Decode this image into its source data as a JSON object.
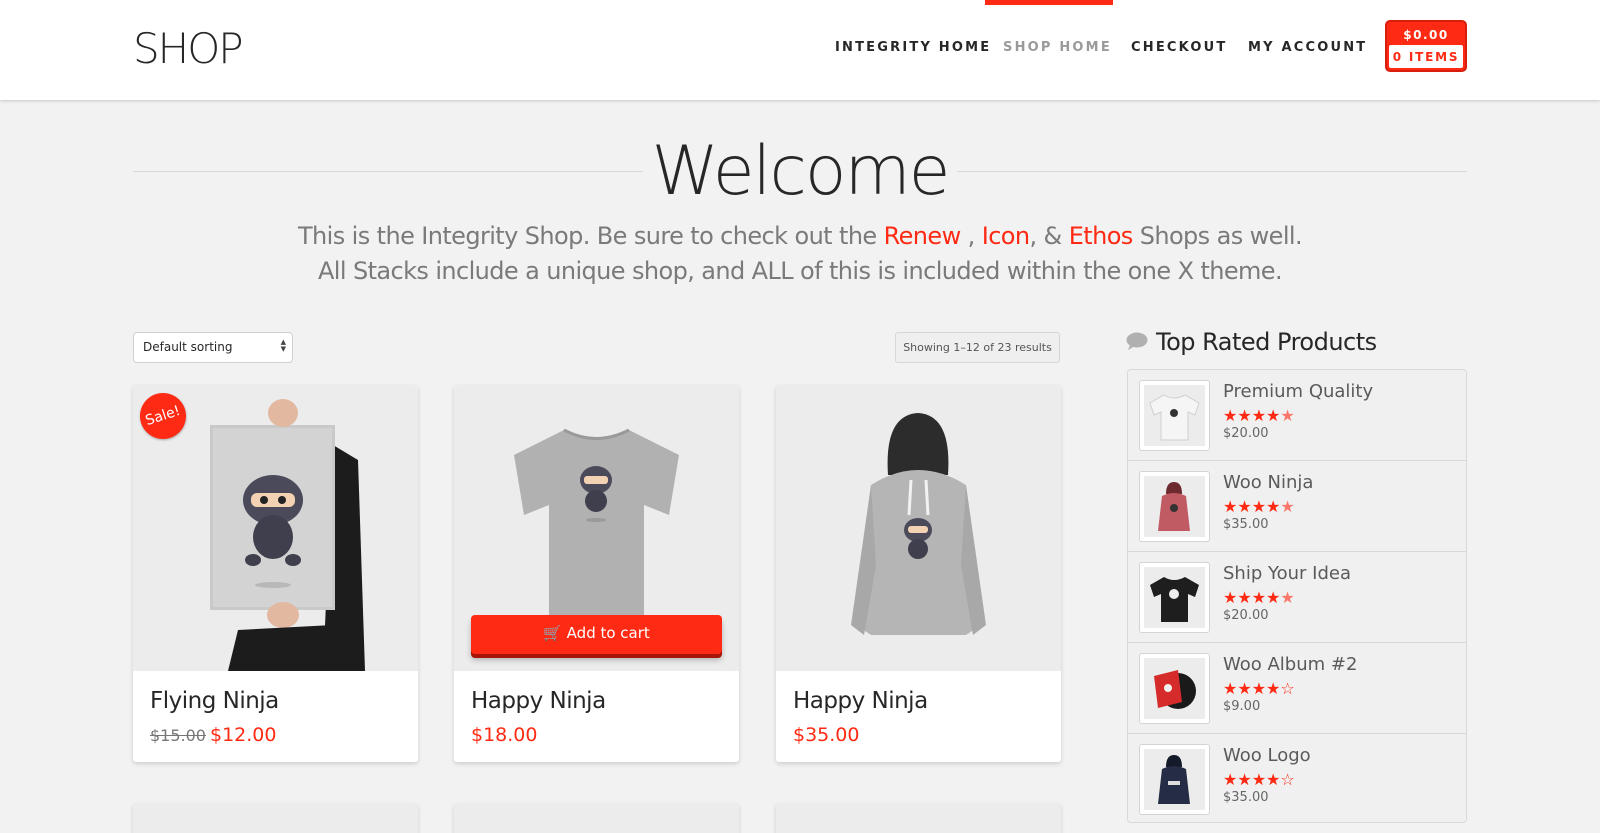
{
  "header": {
    "logo": "SHOP",
    "nav": [
      {
        "label": "INTEGRITY HOME",
        "active": false
      },
      {
        "label": "SHOP HOME",
        "active": true
      },
      {
        "label": "CHECKOUT",
        "active": false
      },
      {
        "label": "MY ACCOUNT",
        "active": false
      }
    ],
    "cart": {
      "total": "$0.00",
      "items": "0 ITEMS"
    }
  },
  "welcome": {
    "title": "Welcome",
    "line1_a": "This is the Integrity Shop. Be sure to check out the ",
    "link_renew": "Renew",
    "sep1": " , ",
    "link_icon": "Icon",
    "sep2": ", & ",
    "link_ethos": "Ethos",
    "line1_b": " Shops as well.",
    "line2": "All Stacks include a unique shop, and ALL of this is included within the one X theme."
  },
  "controls": {
    "sort_value": "Default sorting",
    "result_count": "Showing 1–12 of 23 results"
  },
  "products": [
    {
      "title": "Flying Ninja",
      "old_price": "$15.00",
      "price": "$12.00",
      "sale_badge": "Sale!",
      "image": "ninja-poster"
    },
    {
      "title": "Happy Ninja",
      "price": "$18.00",
      "add_to_cart": "Add to cart",
      "image": "ninja-tshirt"
    },
    {
      "title": "Happy Ninja",
      "price": "$35.00",
      "image": "ninja-hoodie"
    }
  ],
  "sidebar": {
    "title": "Top Rated Products",
    "icon": "speech-bubble-icon",
    "items": [
      {
        "name": "Premium Quality",
        "rating": 4.5,
        "price": "$20.00",
        "image": "white-tshirt"
      },
      {
        "name": "Woo Ninja",
        "rating": 4.5,
        "price": "$35.00",
        "image": "red-hoodie"
      },
      {
        "name": "Ship Your Idea",
        "rating": 4.5,
        "price": "$20.00",
        "image": "black-tshirt"
      },
      {
        "name": "Woo Album #2",
        "rating": 4,
        "price": "$9.00",
        "image": "album"
      },
      {
        "name": "Woo Logo",
        "rating": 4,
        "price": "$35.00",
        "image": "navy-hoodie"
      }
    ]
  },
  "colors": {
    "accent": "#ff2a13",
    "text": "#272727",
    "background": "#f2f2f2"
  }
}
